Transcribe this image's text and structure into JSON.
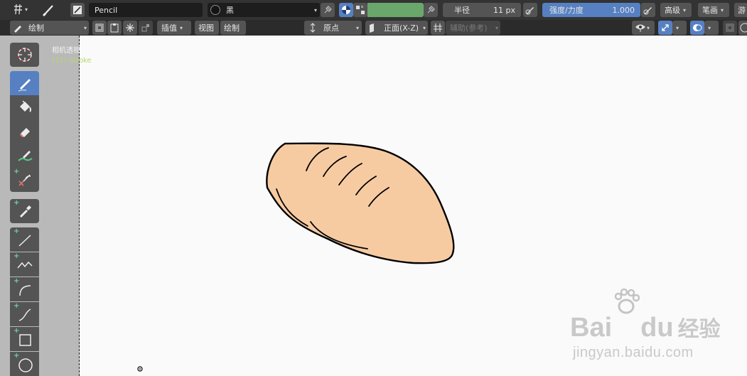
{
  "header": {
    "brush_name": "Pencil",
    "material_name": "黑",
    "radius_label": "半径",
    "radius_value": "11 px",
    "strength_label": "强度/力度",
    "strength_value": "1.000",
    "advanced_label": "高级",
    "stroke_label": "笔画",
    "cut_label": "游",
    "color_swatch": "#6aa76a"
  },
  "header2": {
    "mode_label": "绘制",
    "interp_label": "插值",
    "view_menu": "视图",
    "draw_menu": "绘制",
    "origin_label": "原点",
    "plane_label": "正面(X-Z)",
    "guides_label": "辅助(参考)"
  },
  "viewport": {
    "camera_label": "相机透视",
    "object_label": "(27) Stroke",
    "fill_color": "#f7cba2",
    "background": "#fafafa"
  },
  "watermark": {
    "brand_left": "Bai",
    "brand_right": "du",
    "brand_cn": "经验",
    "url": "jingyan.baidu.com"
  },
  "tools": [
    "cursor-tool",
    "draw-tool",
    "fill-tool",
    "erase-tool",
    "tint-tool",
    "cutter-tool",
    "eyedropper-tool",
    "line-tool",
    "polyline-tool",
    "arc-tool",
    "curve-tool",
    "box-tool",
    "circle-tool"
  ]
}
